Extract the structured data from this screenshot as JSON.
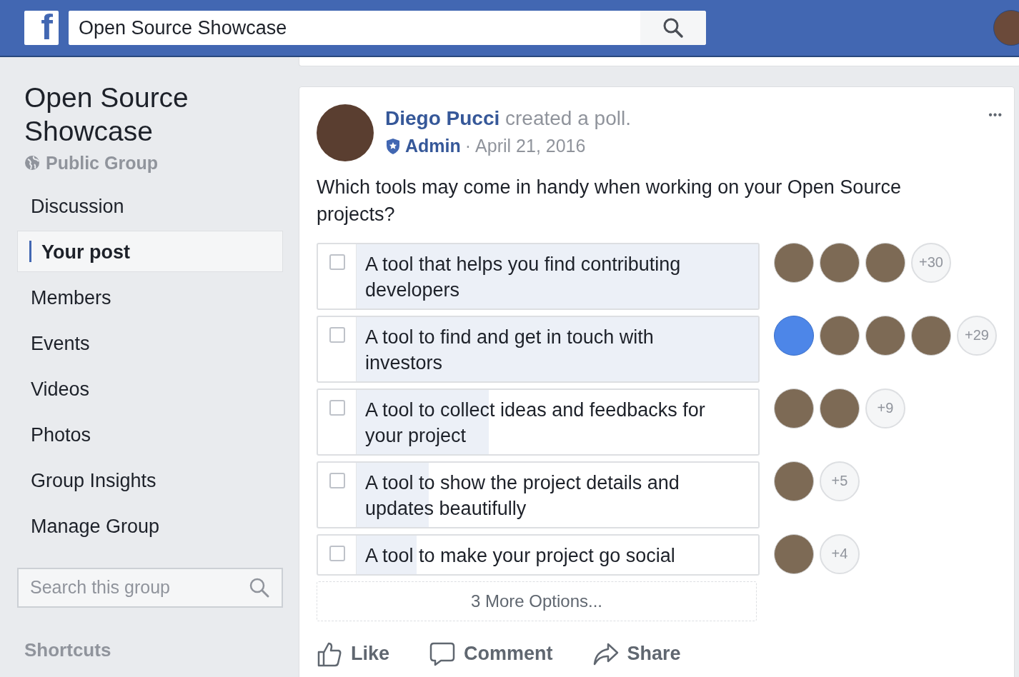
{
  "header": {
    "logo": "f",
    "search_value": "Open Source Showcase"
  },
  "sidebar": {
    "title": "Open Source Showcase",
    "privacy": "Public Group",
    "items": [
      {
        "label": "Discussion",
        "selected": false
      },
      {
        "label": "Your post",
        "selected": true
      },
      {
        "label": "Members",
        "selected": false
      },
      {
        "label": "Events",
        "selected": false
      },
      {
        "label": "Videos",
        "selected": false
      },
      {
        "label": "Photos",
        "selected": false
      },
      {
        "label": "Group Insights",
        "selected": false
      },
      {
        "label": "Manage Group",
        "selected": false
      }
    ],
    "search": {
      "placeholder": "Search this group"
    },
    "shortcuts_heading": "Shortcuts"
  },
  "post": {
    "author": "Diego Pucci",
    "action": "created a poll.",
    "role": "Admin",
    "separator": "·",
    "date": "April 21, 2016",
    "more": "•••",
    "question": "Which tools may come in handy when working on your Open Source projects?",
    "options": [
      {
        "label": "A tool that helps you find contributing developers",
        "checked": false,
        "level": 1.0,
        "voters": [
          {
            "kind": "photo"
          },
          {
            "kind": "photo"
          },
          {
            "kind": "photo"
          }
        ],
        "more_voters": "+30"
      },
      {
        "label": "A tool to find and get in touch with investors",
        "checked": false,
        "level": 1.0,
        "voters": [
          {
            "kind": "logo"
          },
          {
            "kind": "photo"
          },
          {
            "kind": "photo"
          },
          {
            "kind": "photo"
          }
        ],
        "more_voters": "+29"
      },
      {
        "label": "A tool to collect ideas and feedbacks for your project",
        "checked": false,
        "level": 0.33,
        "voters": [
          {
            "kind": "photo"
          },
          {
            "kind": "photo"
          }
        ],
        "more_voters": "+9"
      },
      {
        "label": "A tool to show the project details and updates beautifully",
        "checked": false,
        "level": 0.18,
        "voters": [
          {
            "kind": "photo"
          }
        ],
        "more_voters": "+5"
      },
      {
        "label": "A tool to make your project go social",
        "checked": false,
        "level": 0.15,
        "voters": [
          {
            "kind": "photo"
          }
        ],
        "more_voters": "+4"
      }
    ],
    "more_options": "3 More Options...",
    "actions": [
      {
        "kind": "like",
        "label": "Like"
      },
      {
        "kind": "comment",
        "label": "Comment"
      },
      {
        "kind": "share",
        "label": "Share"
      }
    ]
  }
}
